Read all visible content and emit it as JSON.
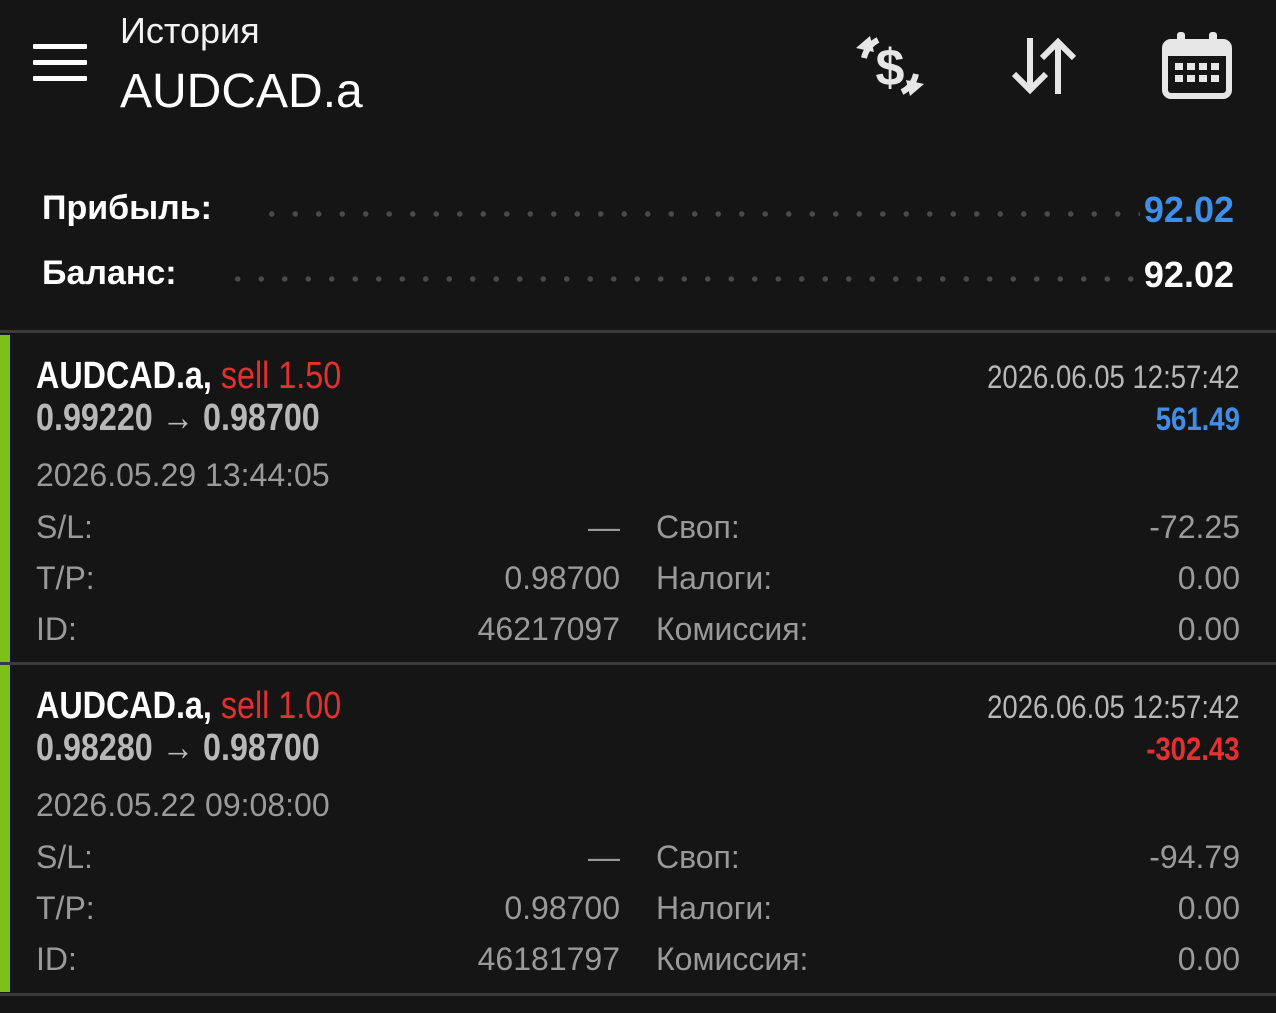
{
  "header": {
    "subtitle": "История",
    "title": "AUDCAD.a",
    "icons": [
      "currency-exchange-icon",
      "sort-arrows-icon",
      "calendar-icon"
    ]
  },
  "summary": {
    "profit_label": "Прибыль:",
    "profit_value": "92.02",
    "balance_label": "Баланс:",
    "balance_value": "92.02"
  },
  "deals": [
    {
      "symbol": "AUDCAD.a,",
      "side": "sell 1.50",
      "prices": "0.99220 → 0.98700",
      "close_time": "2026.06.05 12:57:42",
      "profit": "561.49",
      "open_time": "2026.05.29 13:44:05",
      "sl_label": "S/L:",
      "sl_value": "—",
      "tp_label": "T/P:",
      "tp_value": "0.98700",
      "id_label": "ID:",
      "id_value": "46217097",
      "swap_label": "Своп:",
      "swap_value": "-72.25",
      "taxes_label": "Налоги:",
      "taxes_value": "0.00",
      "commission_label": "Комиссия:",
      "commission_value": "0.00"
    },
    {
      "symbol": "AUDCAD.a,",
      "side": "sell 1.00",
      "prices": "0.98280 → 0.98700",
      "close_time": "2026.06.05 12:57:42",
      "profit": "-302.43",
      "open_time": "2026.05.22 09:08:00",
      "sl_label": "S/L:",
      "sl_value": "—",
      "tp_label": "T/P:",
      "tp_value": "0.98700",
      "id_label": "ID:",
      "id_value": "46181797",
      "swap_label": "Своп:",
      "swap_value": "-94.79",
      "taxes_label": "Налоги:",
      "taxes_value": "0.00",
      "commission_label": "Комиссия:",
      "commission_value": "0.00"
    }
  ],
  "colors": {
    "background": "#151515",
    "profit_positive": "#3f8fe8",
    "profit_negative": "#e53030",
    "sell": "#e53030",
    "accent_bar": "#7fbf1a"
  }
}
